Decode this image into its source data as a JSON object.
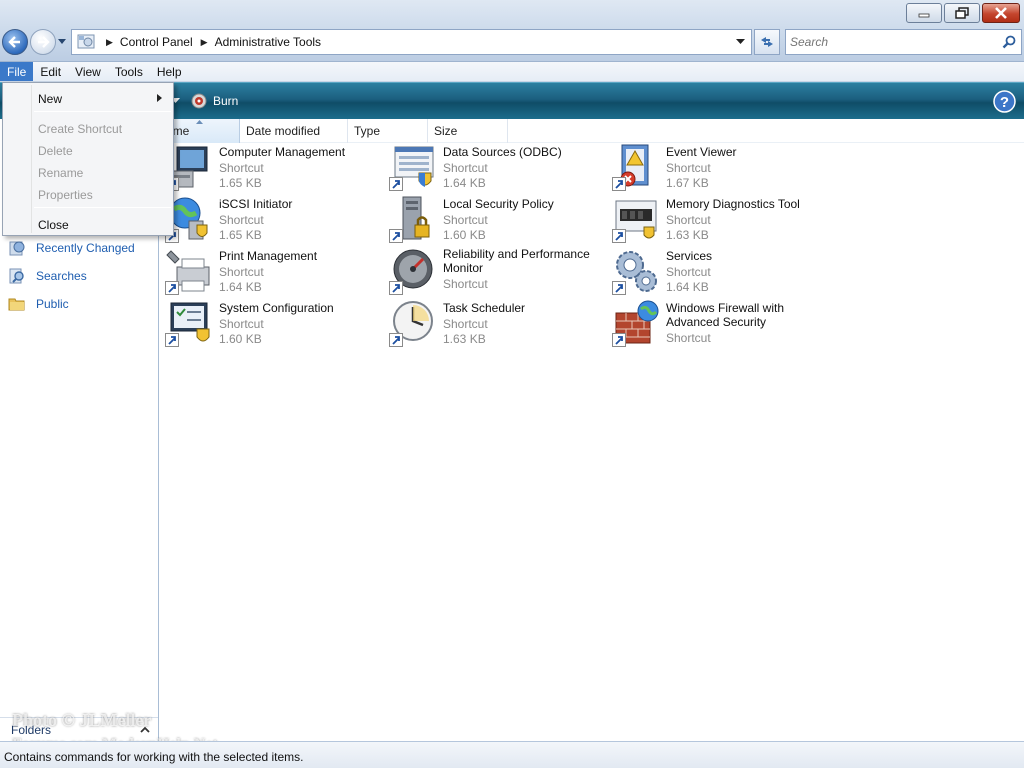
{
  "address": {
    "crumbs": [
      "Control Panel",
      "Administrative Tools"
    ]
  },
  "search": {
    "placeholder": "Search"
  },
  "menubar": {
    "items": [
      "File",
      "Edit",
      "View",
      "Tools",
      "Help"
    ],
    "active": "File"
  },
  "file_menu": {
    "items": [
      {
        "label": "New",
        "enabled": true,
        "submenu": true
      },
      {
        "label": "Create Shortcut",
        "enabled": false
      },
      {
        "label": "Delete",
        "enabled": false
      },
      {
        "label": "Rename",
        "enabled": false
      },
      {
        "label": "Properties",
        "enabled": false
      },
      {
        "label": "Close",
        "enabled": true
      }
    ]
  },
  "command_bar": {
    "burn_label": "Burn"
  },
  "columns": [
    "ame",
    "Date modified",
    "Type",
    "Size"
  ],
  "nav": {
    "links": [
      "Recently Changed",
      "Searches",
      "Public"
    ],
    "folders_label": "Folders"
  },
  "items": [
    {
      "name": "Computer Management",
      "type": "Shortcut",
      "size": "1.65 KB"
    },
    {
      "name": "Data Sources (ODBC)",
      "type": "Shortcut",
      "size": "1.64 KB"
    },
    {
      "name": "Event Viewer",
      "type": "Shortcut",
      "size": "1.67 KB"
    },
    {
      "name": "iSCSI Initiator",
      "type": "Shortcut",
      "size": "1.65 KB"
    },
    {
      "name": "Local Security Policy",
      "type": "Shortcut",
      "size": "1.60 KB"
    },
    {
      "name": "Memory Diagnostics Tool",
      "type": "Shortcut",
      "size": "1.63 KB"
    },
    {
      "name": "Print Management",
      "type": "Shortcut",
      "size": "1.64 KB"
    },
    {
      "name": "Reliability and Performance Monitor",
      "type": "Shortcut",
      "size": ""
    },
    {
      "name": "Services",
      "type": "Shortcut",
      "size": "1.64 KB"
    },
    {
      "name": "System Configuration",
      "type": "Shortcut",
      "size": "1.60 KB"
    },
    {
      "name": "Task Scheduler",
      "type": "Shortcut",
      "size": "1.63 KB"
    },
    {
      "name": "Windows Firewall with Advanced Security",
      "type": "Shortcut",
      "size": ""
    }
  ],
  "status": {
    "text": "Contains commands for working with the selected items."
  },
  "watermark": {
    "line1": "Photo © JLMeller",
    "line2": "Forums.com ModernHelp.Net"
  }
}
